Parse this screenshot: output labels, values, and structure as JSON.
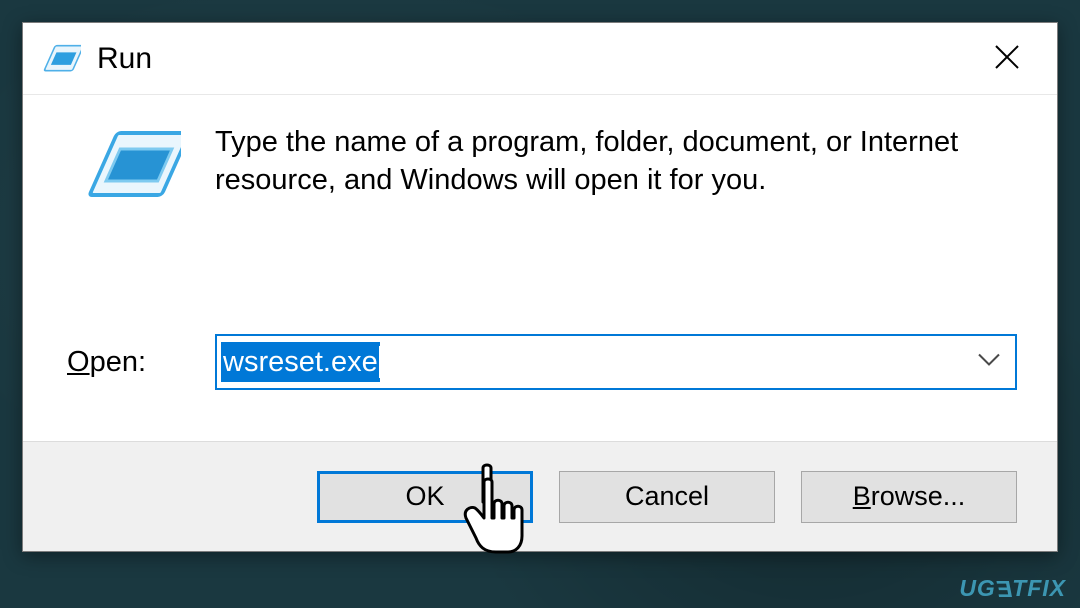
{
  "titlebar": {
    "title": "Run"
  },
  "content": {
    "instruction": "Type the name of a program, folder, document, or Internet resource, and Windows will open it for you.",
    "open_prefix": "O",
    "open_rest": "pen:",
    "input_value": "wsreset.exe"
  },
  "buttons": {
    "ok": "OK",
    "cancel": "Cancel",
    "browse_prefix": "B",
    "browse_rest": "rowse..."
  },
  "watermark": {
    "p1": "UG",
    "p2": "E",
    "p3": "TFIX"
  }
}
